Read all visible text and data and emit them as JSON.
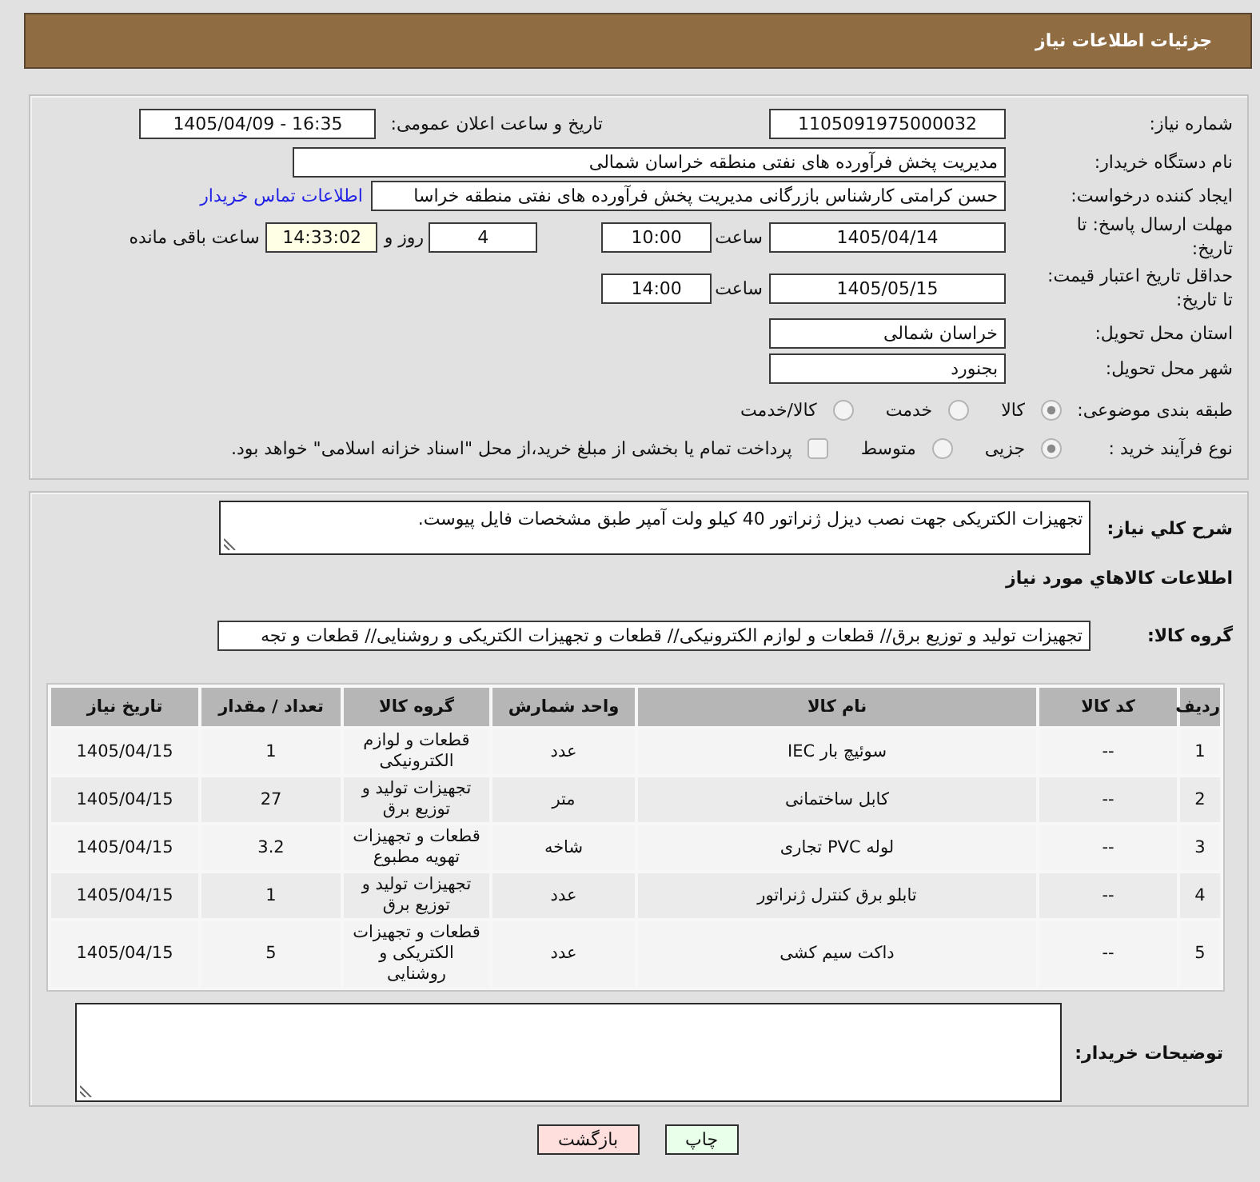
{
  "header": {
    "title": "جزئیات اطلاعات نیاز"
  },
  "details": {
    "need_number": {
      "label": "شماره نیاز:",
      "value": "1105091975000032"
    },
    "announcement": {
      "label": "تاریخ و ساعت اعلان عمومی:",
      "value": "1405/04/09 - 16:35"
    },
    "buyer": {
      "label": "نام دستگاه خریدار:",
      "value": "مدیریت پخش فرآورده های نفتی منطقه خراسان شمالی"
    },
    "requester": {
      "label": "ایجاد کننده درخواست:",
      "value": "حسن کرامتی کارشناس بازرگانی مدیریت پخش فرآورده های نفتی منطقه خراسا",
      "link": "اطلاعات تماس خریدار"
    },
    "response_deadline": {
      "label": "مهلت ارسال پاسخ: تا تاریخ:",
      "date": "1405/04/14",
      "time_label": "ساعت",
      "time": "10:00",
      "days": "4",
      "days_label": "روز و",
      "remaining": "14:33:02",
      "remaining_label": "ساعت باقی مانده"
    },
    "price_validity": {
      "label": "حداقل تاریخ اعتبار قیمت: تا تاریخ:",
      "date": "1405/05/15",
      "time_label": "ساعت",
      "time": "14:00"
    },
    "province": {
      "label": "استان محل تحویل:",
      "value": "خراسان شمالی"
    },
    "city": {
      "label": "شهر محل تحویل:",
      "value": "بجنورد"
    },
    "category": {
      "label": "طبقه بندی موضوعی:",
      "options": [
        {
          "label": "کالا",
          "selected": true
        },
        {
          "label": "خدمت",
          "selected": false
        },
        {
          "label": "کالا/خدمت",
          "selected": false
        }
      ]
    },
    "purchase_process": {
      "label": "نوع فرآیند خرید :",
      "options": [
        {
          "label": "جزیی",
          "selected": true
        },
        {
          "label": "متوسط",
          "selected": false
        }
      ],
      "treasury_payment": {
        "label": "پرداخت تمام یا بخشی از مبلغ خرید،از محل \"اسناد خزانه اسلامی\" خواهد بود.",
        "checked": false
      }
    }
  },
  "needs": {
    "description": {
      "label": "شرح کلي نیاز:",
      "value": "تجهیزات الکتریکی جهت نصب دیزل ژنراتور 40 کیلو ولت آمپر طبق مشخصات فایل پیوست."
    },
    "section_title": "اطلاعات کالاهاي مورد نیاز",
    "goods_group": {
      "label": "گروه کالا:",
      "value": "تجهیزات تولید و توزیع برق// قطعات و لوازم الکترونیکی// قطعات و تجهیزات الکتریکی و روشنایی// قطعات و تجه"
    },
    "table": {
      "columns": [
        "ردیف",
        "کد کالا",
        "نام کالا",
        "واحد شمارش",
        "گروه کالا",
        "تعداد / مقدار",
        "تاریخ نیاز"
      ],
      "rows": [
        {
          "cells": [
            "1",
            "--",
            "سوئیچ بار IEC",
            "عدد",
            "قطعات و لوازم الکترونیکی",
            "1",
            "1405/04/15"
          ]
        },
        {
          "cells": [
            "2",
            "--",
            "کابل ساختمانی",
            "متر",
            "تجهیزات تولید و توزیع برق",
            "27",
            "1405/04/15"
          ]
        },
        {
          "cells": [
            "3",
            "--",
            "لوله PVC تجاری",
            "شاخه",
            "قطعات و تجهیزات تهویه مطبوع",
            "3.2",
            "1405/04/15"
          ]
        },
        {
          "cells": [
            "4",
            "--",
            "تابلو برق کنترل ژنراتور",
            "عدد",
            "تجهیزات تولید و توزیع برق",
            "1",
            "1405/04/15"
          ]
        },
        {
          "cells": [
            "5",
            "--",
            "داکت سیم کشی",
            "عدد",
            "قطعات و تجهیزات الکتریکی و روشنایی",
            "5",
            "1405/04/15"
          ]
        }
      ]
    },
    "buyer_notes": {
      "label": "توضیحات خریدار:"
    }
  },
  "buttons": [
    {
      "label": "چاپ",
      "kind": "print"
    },
    {
      "label": "بازگشت",
      "kind": "back"
    }
  ]
}
